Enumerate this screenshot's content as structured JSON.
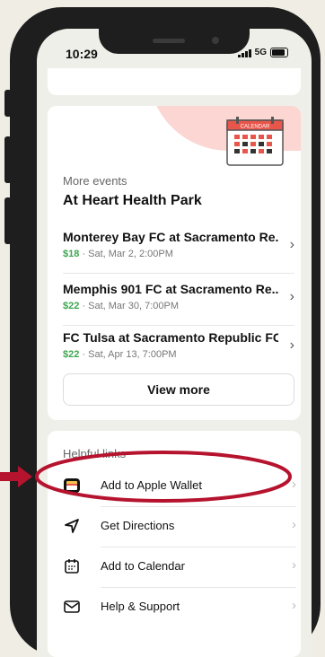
{
  "status_bar": {
    "time": "10:29",
    "network": "5G"
  },
  "events": {
    "subtitle": "More events",
    "title": "At Heart Health Park",
    "calendar_art_label": "CALENDAR",
    "items": [
      {
        "name": "Monterey Bay FC at Sacramento Re...",
        "price": "$18",
        "date": " · Sat, Mar 2, 2:00PM"
      },
      {
        "name": "Memphis 901 FC at Sacramento Re...",
        "price": "$22",
        "date": " · Sat, Mar 30, 7:00PM"
      },
      {
        "name": "FC Tulsa at Sacramento Republic FC",
        "price": "$22",
        "date": " · Sat, Apr 13, 7:00PM"
      }
    ],
    "view_more": "View more"
  },
  "helpful_links": {
    "title": "Helpful links",
    "items": [
      {
        "label": "Add to Apple Wallet",
        "icon": "wallet-icon"
      },
      {
        "label": "Get Directions",
        "icon": "navigation-arrow-icon"
      },
      {
        "label": "Add to Calendar",
        "icon": "calendar-icon"
      },
      {
        "label": "Help & Support",
        "icon": "mail-icon"
      }
    ]
  },
  "colors": {
    "price_green": "#3ea650",
    "annotation_red": "#b5132e",
    "accent_pink": "#fbd6d2"
  }
}
